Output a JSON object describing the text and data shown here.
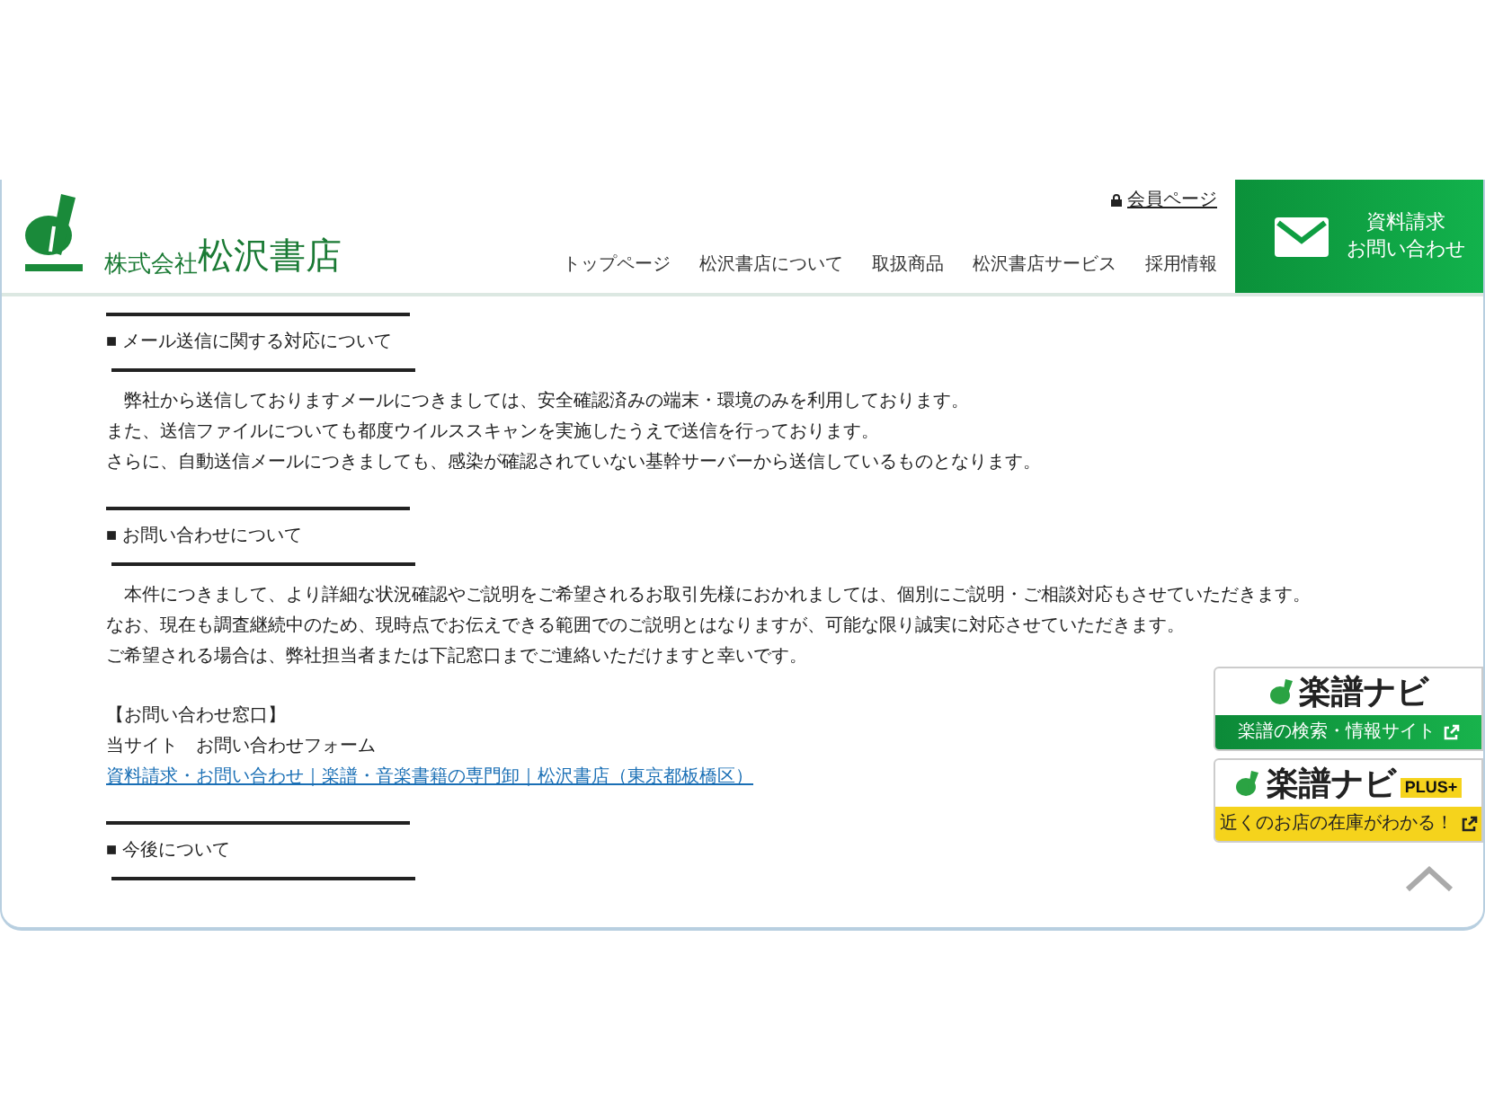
{
  "header": {
    "company_prefix": "株式会社",
    "company_name": "松沢書店",
    "member_link": "会員ページ",
    "nav": [
      {
        "label": "トップページ"
      },
      {
        "label": "松沢書店について"
      },
      {
        "label": "取扱商品"
      },
      {
        "label": "松沢書店サービス"
      },
      {
        "label": "採用情報"
      }
    ],
    "contact_button": [
      "資料請求",
      "お問い合わせ"
    ]
  },
  "sections": [
    {
      "heading": "■ メール送信に関する対応について",
      "blocks": [
        {
          "kind": "text",
          "lines": [
            "　弊社から送信しておりますメールにつきましては、安全確認済みの端末・環境のみを利用しております。",
            "また、送信ファイルについても都度ウイルススキャンを実施したうえで送信を行っております。",
            "さらに、自動送信メールにつきましても、感染が確認されていない基幹サーバーから送信しているものとなります。"
          ]
        }
      ]
    },
    {
      "heading": "■ お問い合わせについて",
      "blocks": [
        {
          "kind": "text",
          "lines": [
            "　本件につきまして、より詳細な状況確認やご説明をご希望されるお取引先様におかれましては、個別にご説明・ご相談対応もさせていただきます。",
            "なお、現在も調査継続中のため、現時点でお伝えできる範囲でのご説明とはなりますが、可能な限り誠実に対応させていただきます。",
            "ご希望される場合は、弊社担当者または下記窓口までご連絡いただけますと幸いです。"
          ]
        },
        {
          "kind": "text",
          "lines": [
            "【お問い合わせ窓口】",
            "当サイト　お問い合わせフォーム"
          ]
        },
        {
          "kind": "link",
          "lines": [
            "資料請求・お問い合わせ｜楽譜・音楽書籍の専門卸｜松沢書店（東京都板橋区）"
          ]
        }
      ]
    },
    {
      "heading": "■ 今後について"
    }
  ],
  "side_banners": [
    {
      "kind": "green",
      "title": "楽譜ナビ",
      "caption": "楽譜の検索・情報サイト"
    },
    {
      "kind": "yellow",
      "title": "楽譜ナビ",
      "badge": "PLUS+",
      "caption": "近くのお店の在庫がわかる！"
    }
  ]
}
